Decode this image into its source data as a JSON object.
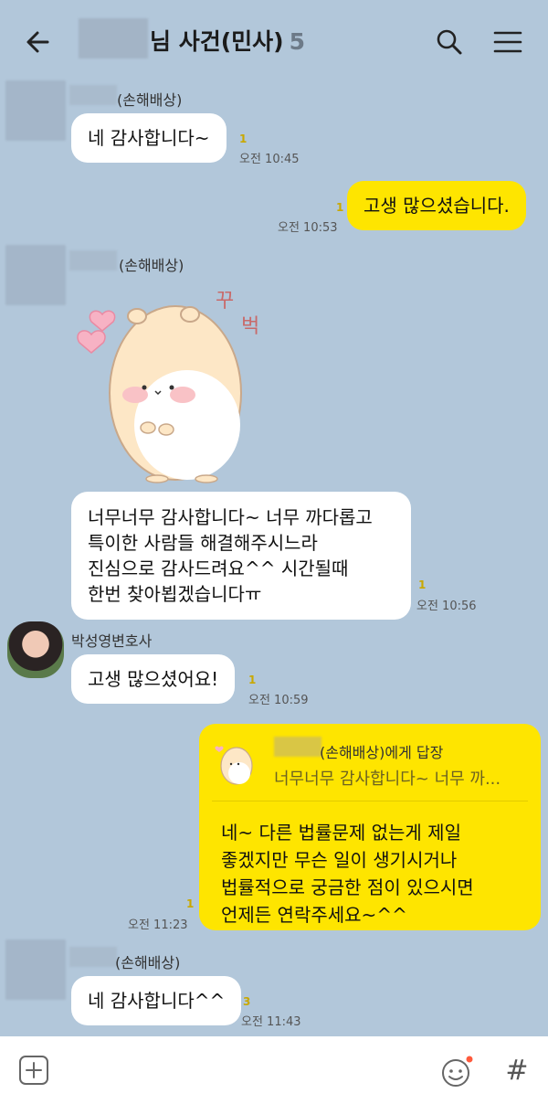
{
  "header": {
    "title": "님 사건(민사)",
    "member_count": "5"
  },
  "messages": {
    "m1": {
      "sender_suffix": "(손해배상)",
      "text": "네 감사합니다~",
      "read": "1",
      "time": "오전 10:45"
    },
    "m2": {
      "text": "고생 많으셨습니다.",
      "read": "1",
      "time": "오전 10:53"
    },
    "m3": {
      "sender_suffix": "(손해배상)",
      "sticker_text_1": "꾸",
      "sticker_text_2": "벅",
      "lines": [
        "너무너무 감사합니다~ 너무 까다롭고",
        "특이한 사람들 해결해주시느라",
        "진심으로 감사드려요^^ 시간될때",
        "한번 찾아뵙겠습니다ㅠ"
      ],
      "read": "1",
      "time": "오전 10:56"
    },
    "m4": {
      "sender": "박성영변호사",
      "text": "고생 많으셨어요!",
      "read": "1",
      "time": "오전 10:59"
    },
    "m5": {
      "reply_to": "(손해배상)에게 답장",
      "quote": "너무너무 감사합니다~ 너무 까...",
      "lines": [
        "네~ 다른 법률문제 없는게 제일",
        "좋겠지만 무슨 일이 생기시거나",
        "법률적으로 궁금한 점이 있으시면",
        "언제든 연락주세요~^^"
      ],
      "read": "1",
      "time": "오전 11:23"
    },
    "m6": {
      "sender_suffix": "(손해배상)",
      "text": "네 감사합니다^^",
      "read": "3",
      "time": "오전 11:43"
    }
  },
  "input_bar": {
    "hash_label": "#"
  },
  "colors": {
    "background": "#b2c7da",
    "my_bubble": "#fee500",
    "other_bubble": "#ffffff",
    "read_count": "#c9a800",
    "notification_dot": "#ff5a3c"
  }
}
